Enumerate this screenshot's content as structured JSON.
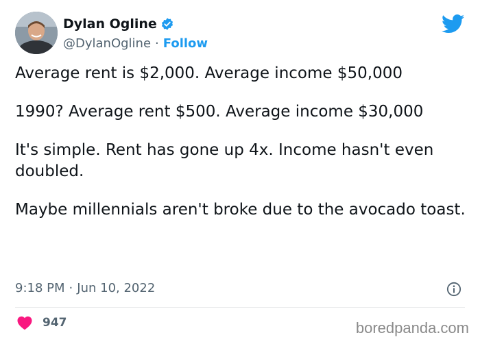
{
  "user": {
    "display_name": "Dylan Ogline",
    "handle": "@DylanOgline",
    "separator": "·",
    "follow_label": "Follow",
    "verified": true
  },
  "tweet": {
    "paragraphs": [
      "Average rent is $2,000. Average income $50,000",
      "1990? Average rent $500. Average income $30,000",
      "It's simple. Rent has gone up 4x. Income hasn't even doubled.",
      "Maybe millennials aren't broke due to the avocado toast."
    ],
    "time": "9:18 PM",
    "separator": "·",
    "date": "Jun 10, 2022"
  },
  "engagement": {
    "likes": "947"
  },
  "watermark": "boredpanda.com",
  "colors": {
    "twitter_blue": "#1d9bf0",
    "like_pink": "#f91880",
    "text_primary": "#0f1419",
    "text_secondary": "#536471"
  },
  "icons": {
    "verified": "verified-badge-icon",
    "logo": "twitter-bird-icon",
    "info": "info-icon",
    "like": "heart-icon"
  }
}
